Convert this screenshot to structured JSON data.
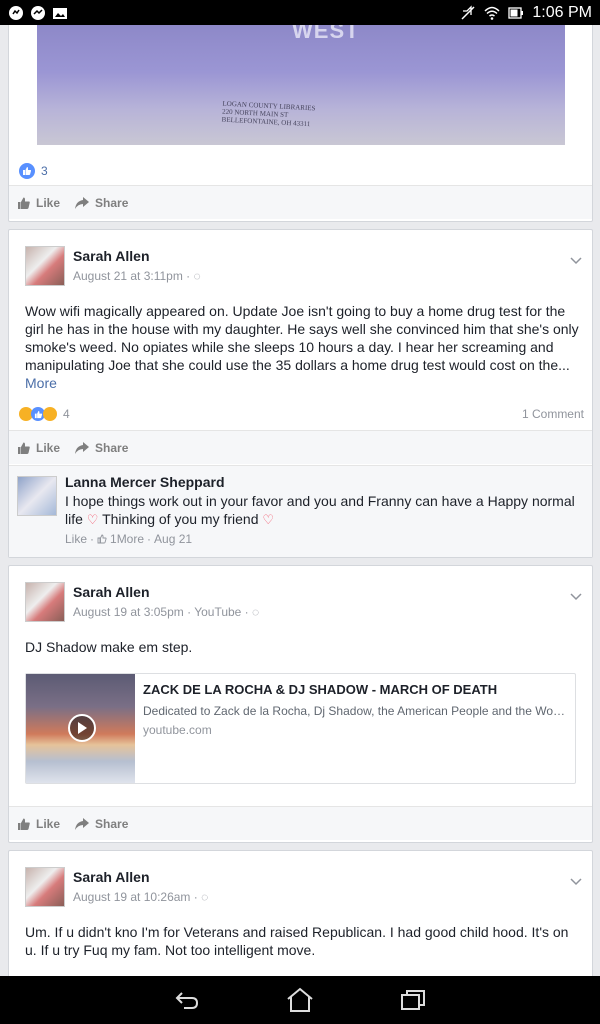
{
  "status_bar": {
    "time": "1:06 PM"
  },
  "post_top": {
    "reaction_count": "3",
    "like_label": "Like",
    "share_label": "Share"
  },
  "post1": {
    "author": "Sarah Allen",
    "timestamp": "August 21 at 3:11pm ·",
    "text": "Wow wifi magically appeared on. Update Joe isn't going to buy a home drug test for the girl he has in the house with my daughter. He says well she convinced him that she's only smoke's weed. No opiates while she sleeps 10 hours a day. I hear her screaming and manipulating Joe that she could use the 35 dollars a home drug test would cost on the...",
    "more_label": "More",
    "reaction_count": "4",
    "comment_count": "1 Comment",
    "like_label": "Like",
    "share_label": "Share",
    "comment": {
      "author": "Lanna Mercer Sheppard",
      "text_1": "I hope things work out in your favor and you and Franny can have a Happy normal life",
      "text_2": "Thinking of you my friend",
      "like_label": "Like",
      "reaction_label": "1More",
      "date": "Aug 21"
    }
  },
  "post2": {
    "author": "Sarah Allen",
    "timestamp": "August 19 at 3:05pm · YouTube ·",
    "text": "DJ Shadow make em step.",
    "link_title": "ZACK DE LA ROCHA & DJ SHADOW - MARCH OF DEATH",
    "link_desc": "Dedicated to Zack de la Rocha, Dj Shadow, the American People and the World...",
    "link_domain": "youtube.com",
    "like_label": "Like",
    "share_label": "Share"
  },
  "post3": {
    "author": "Sarah Allen",
    "timestamp": "August 19 at 10:26am ·",
    "text": "Um. If u didn't kno I'm for Veterans and raised Republican. I had good child hood. It's on u. If u try Fuq my fam. Not too intelligent move."
  },
  "photo_text": {
    "west": "WEST",
    "address": "LOGAN COUNTY LIBRARIES\n220 NORTH MAIN ST\nBELLEFONTAINE, OH 43311"
  },
  "colors": {
    "link": "#4b6ea8",
    "like_blue": "#5890ff",
    "heart": "#f25268"
  }
}
